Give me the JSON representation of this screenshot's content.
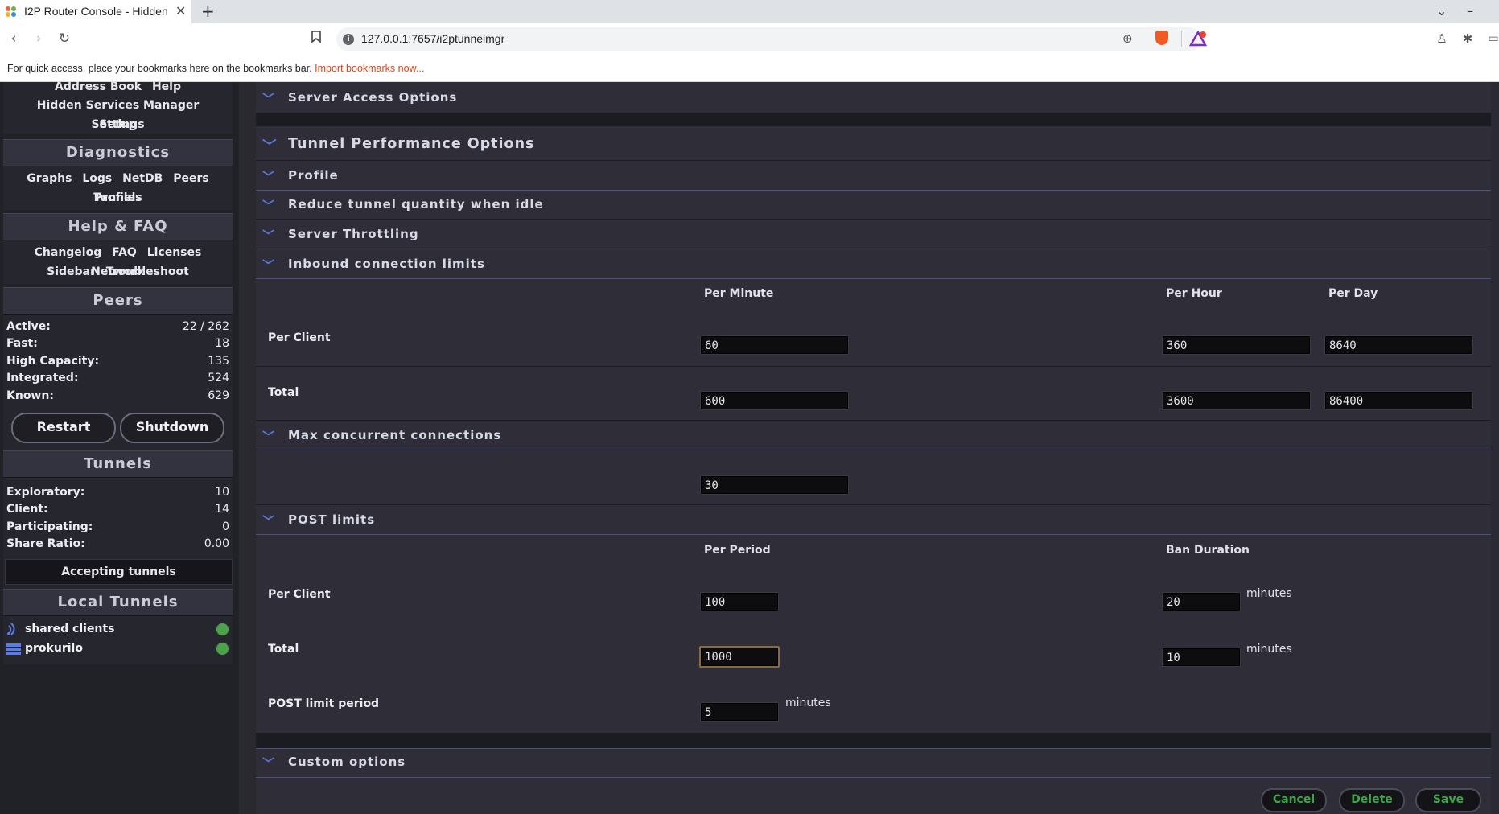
{
  "browser": {
    "tab_title": "I2P Router Console - Hidden Services Manager",
    "close": "✕",
    "new_tab": "+",
    "url": "127.0.0.1:7657/i2ptunnelmgr",
    "bookmarks_text": "For quick access, place your bookmarks here on the bookmarks bar.",
    "bookmarks_link": "Import bookmarks now..."
  },
  "sidebar": {
    "top_links_row1": [
      "Address Book",
      "Help"
    ],
    "top_links_row2": [
      "Hidden Services Manager",
      "Settings"
    ],
    "top_links_row3": [
      "Setup"
    ],
    "diagnostics": {
      "title": "Diagnostics",
      "row1": [
        "Graphs",
        "Logs",
        "NetDB",
        "Peers",
        "Profiles"
      ],
      "row2": [
        "Tunnels"
      ]
    },
    "help": {
      "title": "Help & FAQ",
      "row1": [
        "Changelog",
        "FAQ",
        "Licenses",
        "Network"
      ],
      "row2": [
        "Sidebar",
        "Troubleshoot"
      ]
    },
    "peers": {
      "title": "Peers",
      "stats": [
        {
          "label": "Active:",
          "value": "22 / 262"
        },
        {
          "label": "Fast:",
          "value": "18"
        },
        {
          "label": "High Capacity:",
          "value": "135"
        },
        {
          "label": "Integrated:",
          "value": "524"
        },
        {
          "label": "Known:",
          "value": "629"
        }
      ]
    },
    "restart": "Restart",
    "shutdown": "Shutdown",
    "tunnels": {
      "title": "Tunnels",
      "stats": [
        {
          "label": "Exploratory:",
          "value": "10"
        },
        {
          "label": "Client:",
          "value": "14"
        },
        {
          "label": "Participating:",
          "value": "0"
        },
        {
          "label": "Share Ratio:",
          "value": "0.00"
        }
      ]
    },
    "accepting": "Accepting tunnels",
    "local_tunnels": {
      "title": "Local Tunnels",
      "items": [
        {
          "name": "shared clients",
          "status_color": "#4ea24b"
        },
        {
          "name": "prokurilo",
          "status_color": "#4ea24b"
        }
      ]
    }
  },
  "main": {
    "server_access": "Server Access Options",
    "perf_title": "Tunnel Performance Options",
    "profile": "Profile",
    "reduce": "Reduce tunnel quantity when idle",
    "throttling": "Server Throttling",
    "inbound": "Inbound connection limits",
    "col_per_minute": "Per Minute",
    "col_per_hour": "Per Hour",
    "col_per_day": "Per Day",
    "per_client": "Per Client",
    "total": "Total",
    "per_client_minute": "60",
    "per_client_hour": "360",
    "per_client_day": "8640",
    "total_minute": "600",
    "total_hour": "3600",
    "total_day": "86400",
    "max_concurrent": "Max concurrent connections",
    "max_concurrent_value": "30",
    "post_limits": "POST limits",
    "col_per_period": "Per Period",
    "col_ban_duration": "Ban Duration",
    "post_per_client_period": "100",
    "post_per_client_ban": "20",
    "post_total_period": "1000",
    "post_total_ban": "10",
    "minutes": "minutes",
    "post_limit_period_label": "POST limit period",
    "post_limit_period_value": "5",
    "custom_options": "Custom options",
    "cancel": "Cancel",
    "delete": "Delete",
    "save": "Save"
  }
}
